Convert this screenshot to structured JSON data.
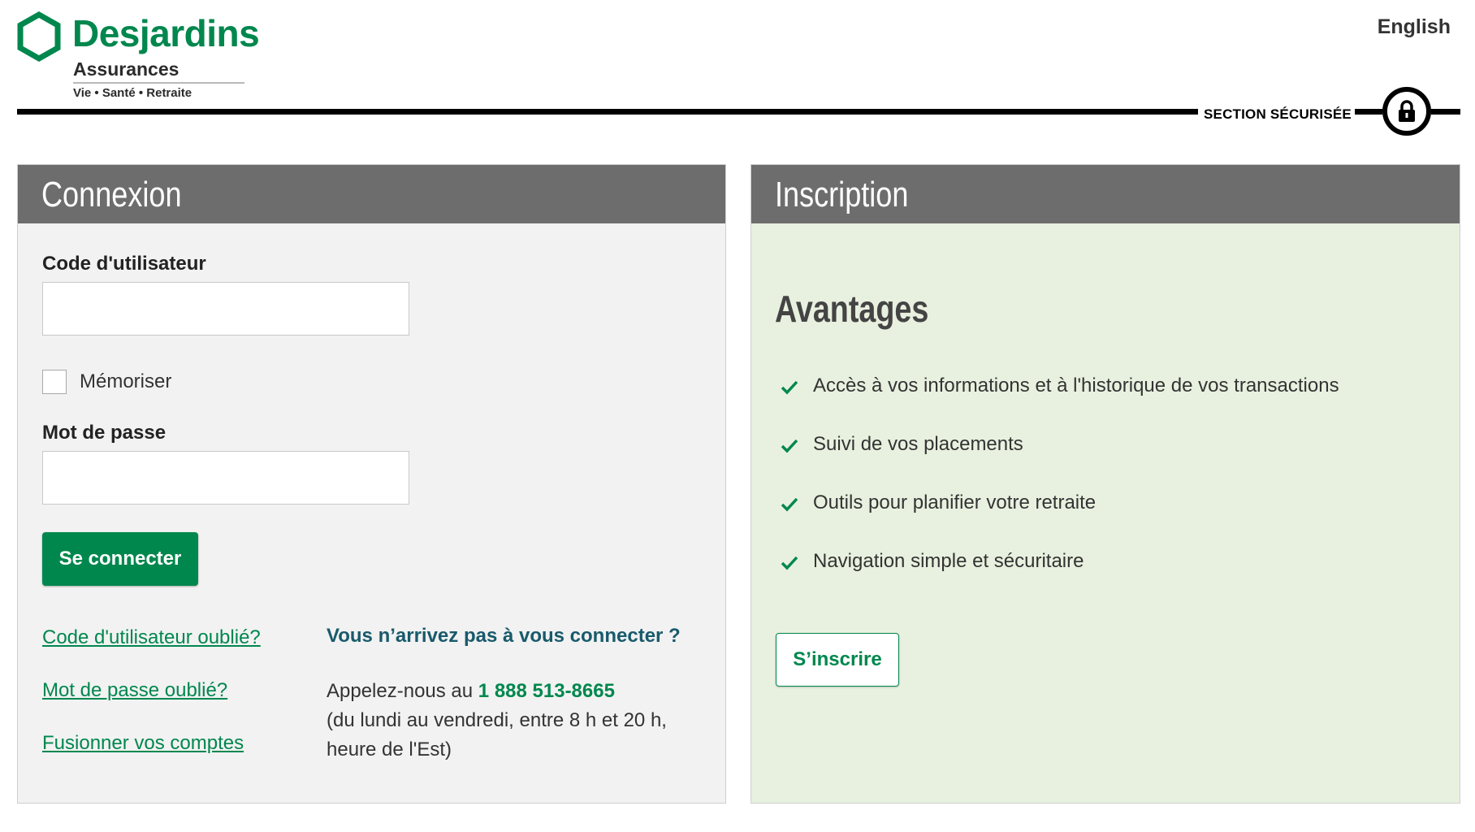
{
  "header": {
    "brand": "Desjardins",
    "brand_sub": "Assurances",
    "brand_tagline": "Vie • Santé • Retraite",
    "language_link": "English",
    "secure_label": "SECTION SÉCURISÉE",
    "lock_icon": "lock-icon"
  },
  "login": {
    "title": "Connexion",
    "username_label": "Code d'utilisateur",
    "username_value": "",
    "remember_label": "Mémoriser",
    "password_label": "Mot de passe",
    "password_value": "",
    "submit_label": "Se connecter",
    "links": {
      "forgot_user": "Code d'utilisateur oublié?",
      "forgot_password": "Mot de passe oublié?",
      "merge_accounts": "Fusionner vos comptes"
    },
    "help": {
      "title": "Vous n’arrivez pas à vous connecter ?",
      "call_prefix": "Appelez-nous au ",
      "phone": "1 888 513-8665",
      "hours_line1": "(du lundi au vendredi, entre 8 h et 20 h,",
      "hours_line2": "heure de l'Est)"
    }
  },
  "register": {
    "title": "Inscription",
    "advantages_title": "Avantages",
    "advantages": [
      "Accès à vos informations et à l'historique de vos transactions",
      "Suivi de vos placements",
      "Outils pour planifier votre retraite",
      "Navigation simple et sécuritaire"
    ],
    "submit_label": "S’inscrire"
  },
  "colors": {
    "brand_green": "#00874e",
    "header_gray": "#6d6d6d",
    "login_bg": "#f2f2f2",
    "register_bg": "#e8f1df",
    "help_title": "#185a6b"
  }
}
